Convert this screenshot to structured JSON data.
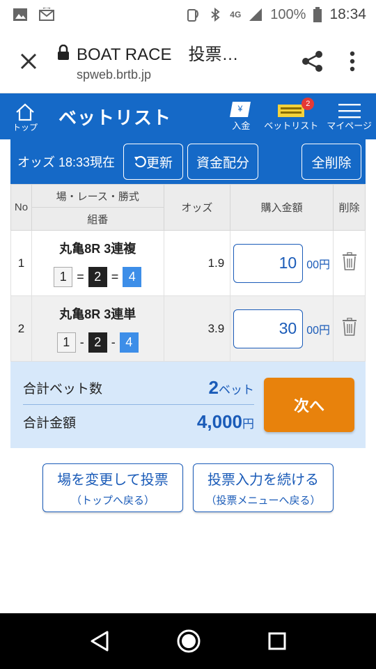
{
  "status_bar": {
    "network": "4G",
    "battery": "100%",
    "time": "18:34"
  },
  "browser": {
    "title": "BOAT RACE　投票…",
    "url": "spweb.brtb.jp"
  },
  "header": {
    "home_label": "トップ",
    "title": "ベットリスト",
    "nav": [
      {
        "label": "入金"
      },
      {
        "label": "ベットリスト",
        "badge": "2"
      },
      {
        "label": "マイページ"
      }
    ]
  },
  "actions": {
    "odds_time": "オッズ 18:33現在",
    "refresh": "更新",
    "allocate": "資金配分",
    "delete_all": "全削除"
  },
  "table": {
    "headers": {
      "no": "No",
      "race": "場・レース・勝式",
      "combo": "組番",
      "odds": "オッズ",
      "amount": "購入金額",
      "delete": "削除"
    },
    "rows": [
      {
        "no": "1",
        "race": "丸亀8R 3連複",
        "nums": [
          "1",
          "2",
          "4"
        ],
        "seps": [
          "=",
          "="
        ],
        "odds": "1.9",
        "amount": "10",
        "unit": "00円"
      },
      {
        "no": "2",
        "race": "丸亀8R 3連単",
        "nums": [
          "1",
          "2",
          "4"
        ],
        "seps": [
          "-",
          "-"
        ],
        "odds": "3.9",
        "amount": "30",
        "unit": "00円"
      }
    ]
  },
  "summary": {
    "count_label": "合計ベット数",
    "count_value": "2",
    "count_unit": "ベット",
    "total_label": "合計金額",
    "total_value": "4,000",
    "total_unit": "円",
    "next": "次へ"
  },
  "links": [
    {
      "main": "場を変更して投票",
      "sub": "（トップへ戻る）"
    },
    {
      "main": "投票入力を続ける",
      "sub": "（投票メニューへ戻る）"
    }
  ]
}
